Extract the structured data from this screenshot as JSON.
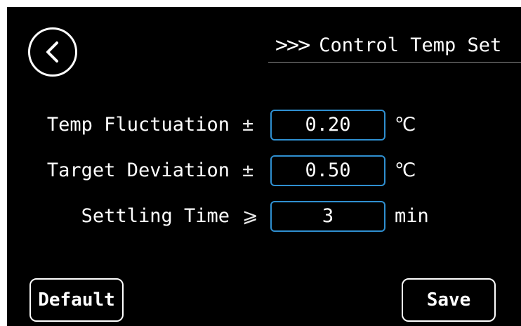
{
  "header": {
    "arrows": ">>>",
    "title": "Control Temp Set"
  },
  "settings": [
    {
      "label": "Temp Fluctuation",
      "symbol": "±",
      "value": "0.20",
      "unit": "℃"
    },
    {
      "label": "Target Deviation",
      "symbol": "±",
      "value": "0.50",
      "unit": "℃"
    },
    {
      "label": "Settling Time",
      "symbol": "⩾",
      "value": "3",
      "unit": "min"
    }
  ],
  "buttons": {
    "default_label": "Default",
    "save_label": "Save"
  },
  "icons": {
    "back": "chevron-left-icon"
  },
  "colors": {
    "background": "#000000",
    "field_border": "#2f8fd0",
    "text": "#ffffff"
  }
}
